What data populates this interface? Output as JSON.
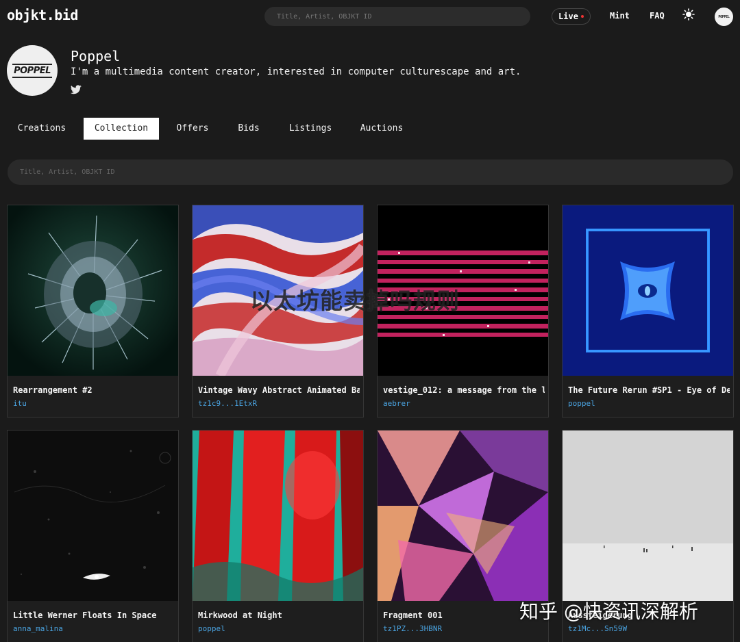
{
  "header": {
    "logo": "objkt.bid",
    "search_placeholder": "Title, Artist, OBJKT ID",
    "live_label": "Live",
    "mint_label": "Mint",
    "faq_label": "FAQ",
    "theme_icon": "sun-icon",
    "avatar_text": "POPPEL"
  },
  "profile": {
    "avatar_text": "POPPEL",
    "name": "Poppel",
    "bio": "I'm a multimedia content creator, interested in computer culturescape and art.",
    "social_icon": "twitter-icon"
  },
  "tabs": [
    {
      "label": "Creations",
      "active": false
    },
    {
      "label": "Collection",
      "active": true
    },
    {
      "label": "Offers",
      "active": false
    },
    {
      "label": "Bids",
      "active": false
    },
    {
      "label": "Listings",
      "active": false
    },
    {
      "label": "Auctions",
      "active": false
    }
  ],
  "search": {
    "placeholder": "Title, Artist, OBJKT ID"
  },
  "cards": [
    {
      "title": "Rearrangement #2",
      "creator": "itu"
    },
    {
      "title": "Vintage Wavy Abstract Animated Ba",
      "creator": "tz1c9...1EtxR"
    },
    {
      "title": "vestige_012: a message from the l",
      "creator": "aebrer"
    },
    {
      "title": "The Future Rerun #SP1 - Eye of De",
      "creator": "poppel"
    },
    {
      "title": "Little Werner Floats In Space",
      "creator": "anna_malina"
    },
    {
      "title": "Mirkwood at Night",
      "creator": "poppel"
    },
    {
      "title": "Fragment 001",
      "creator": "tz1PZ...3HBNR"
    },
    {
      "title": "Aussteigerung",
      "creator": "tz1Mc...Sn59W"
    }
  ],
  "overlay": {
    "text": "以太坊能卖掉吗规则"
  },
  "watermark": {
    "text": "知乎 @快资讯深解析"
  },
  "colors": {
    "background": "#1b1b1b",
    "link": "#4aa3e0",
    "live_dot": "#e33333"
  }
}
